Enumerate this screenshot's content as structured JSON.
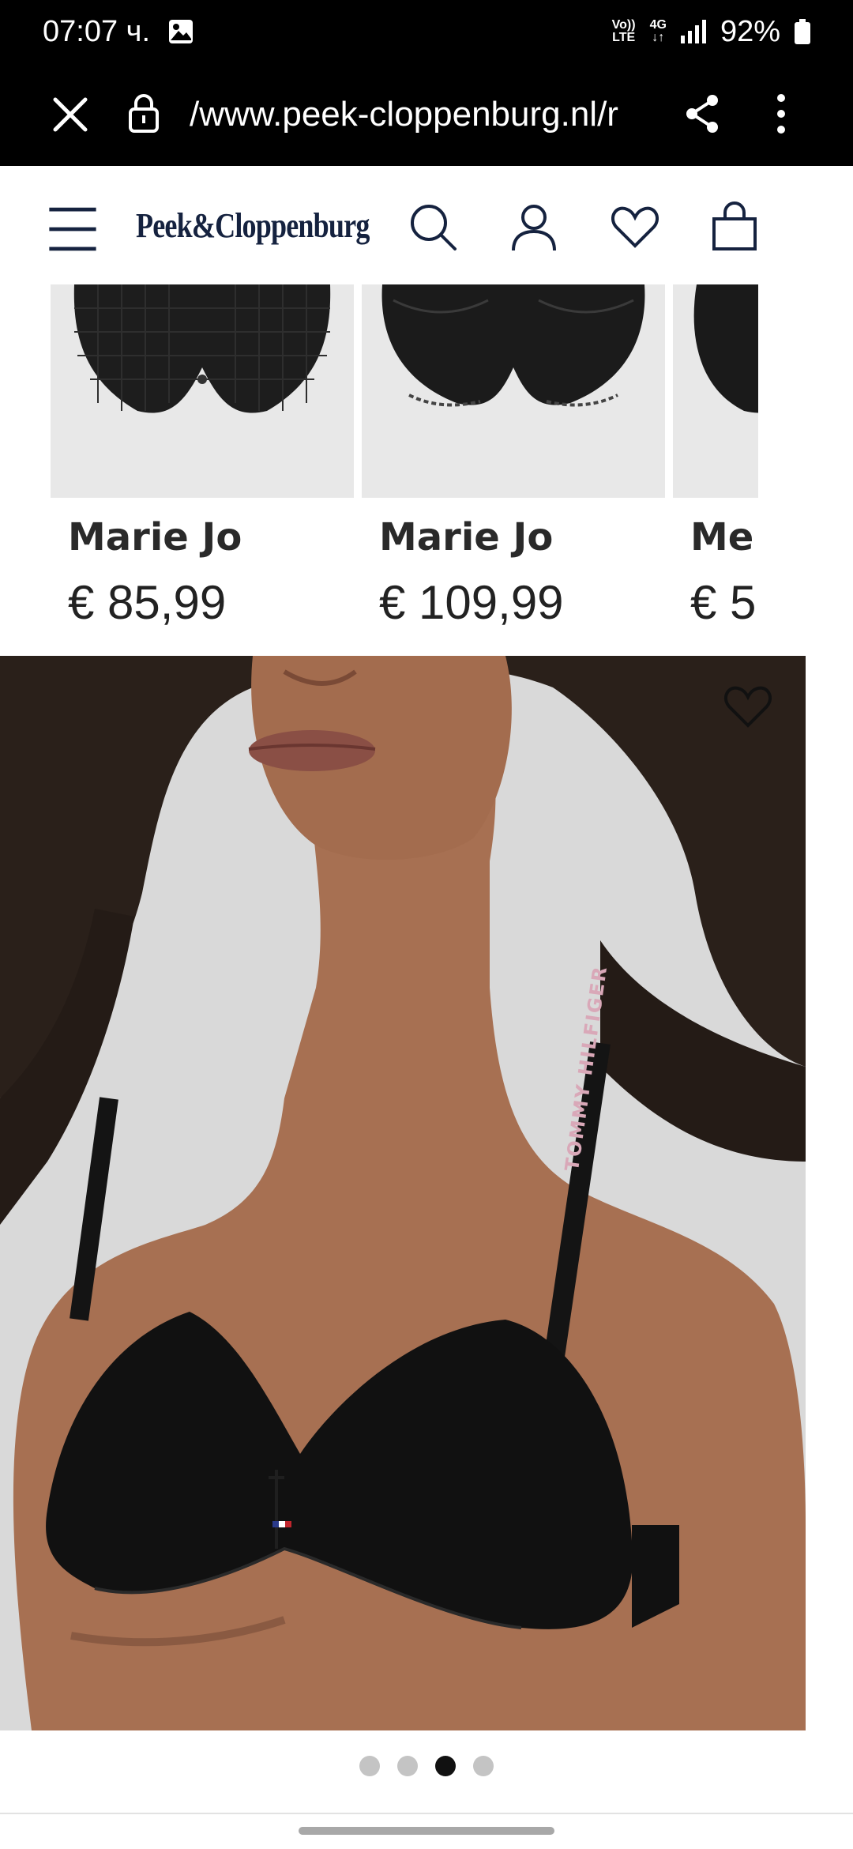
{
  "status_bar": {
    "time": "07:07 ч.",
    "network_top": "Vo))",
    "network_bottom": "LTE",
    "gen": "4G",
    "battery": "92%"
  },
  "browser": {
    "url": "/www.peek-cloppenburg.nl/r"
  },
  "header": {
    "logo": "Peek&Cloppenburg"
  },
  "products": [
    {
      "brand": "Marie Jo",
      "price": "€ 85,99"
    },
    {
      "brand": "Marie Jo",
      "price": "€ 109,99"
    },
    {
      "brand": "Me",
      "price": "€ 5"
    }
  ],
  "hero": {
    "strap_text": "TOMMY HILFIGER"
  },
  "pagination": {
    "count": 4,
    "active_index": 2
  }
}
